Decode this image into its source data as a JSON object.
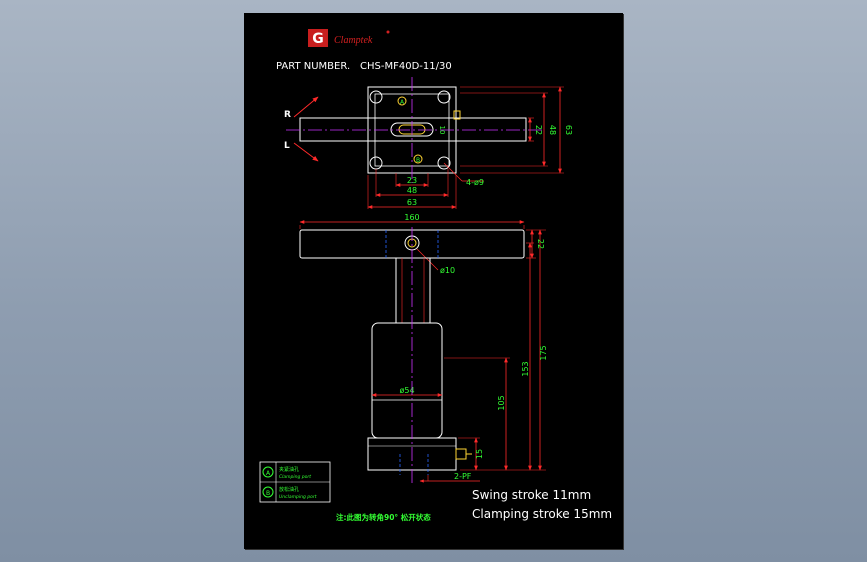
{
  "title_block": {
    "brand": "Clamptek",
    "brand_mark": "G",
    "part_number_label": "PART NUMBER.",
    "part_number": "CHS-MF40D-11/30"
  },
  "top_view": {
    "rotation_right": "R",
    "rotation_left": "L",
    "port_a": "A",
    "port_b": "B",
    "dim_height_inner": "22",
    "dim_height_mid": "48",
    "dim_height_outer": "63",
    "dim_slot_width": "10",
    "dim_width_inner": "23",
    "dim_width_mid": "48",
    "dim_width_outer": "63",
    "hole_callout": "4-ø9"
  },
  "front_view": {
    "dim_arm_length": "160",
    "dim_arm_thickness": "22",
    "pin_diameter": "ø10",
    "body_diameter": "ø54",
    "dim_height_105": "105",
    "dim_height_153": "153",
    "dim_height_175": "175",
    "dim_flange_height": "15",
    "port_callout": "2-PF"
  },
  "legend": {
    "items": [
      {
        "marker": "A",
        "label_cn": "夹紧油孔",
        "label_en": "Clamping port"
      },
      {
        "marker": "B",
        "label_cn": "放松油孔",
        "label_en": "Unclamping port"
      }
    ],
    "note": "注:此图为转角90° 松开状态"
  },
  "spec": {
    "swing_stroke": "Swing stroke 11mm",
    "clamping_stroke": "Clamping stroke 15mm"
  },
  "colors": {
    "sheet": "#000000",
    "outline": "#ffffff",
    "dimension": "#ff2a2a",
    "centerline": "#cc33ff",
    "legend_text": "#33ff33",
    "brand": "#d42020",
    "hole": "#ffd633"
  }
}
